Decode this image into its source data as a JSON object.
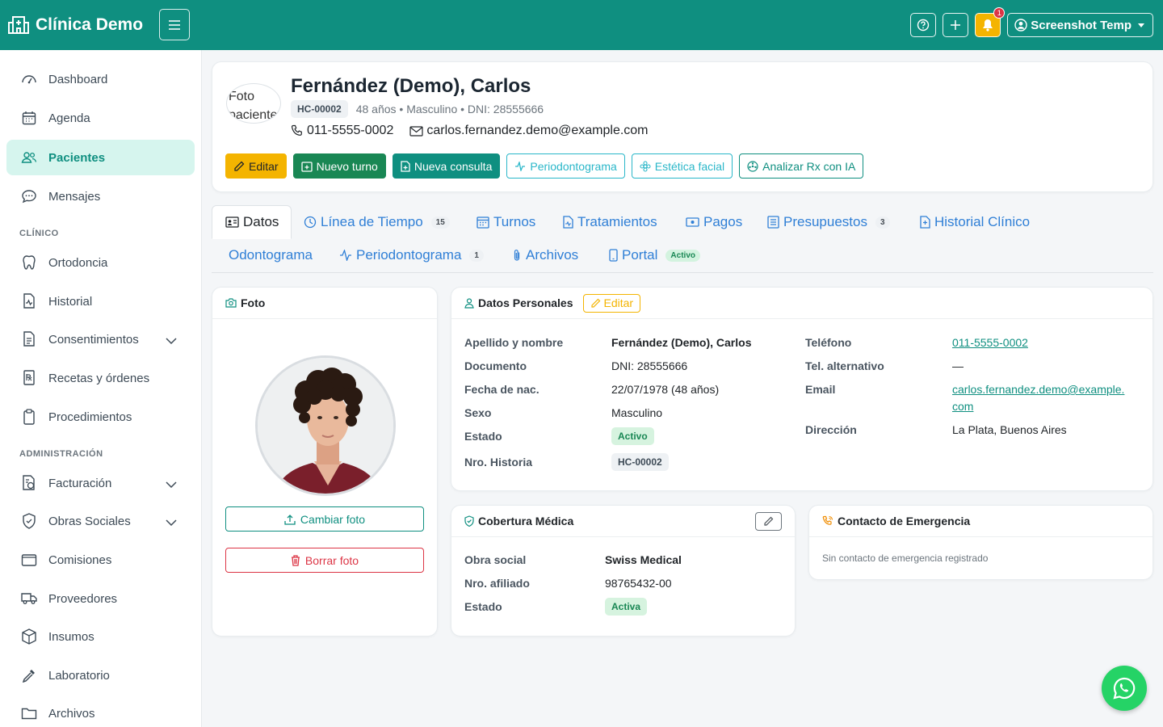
{
  "brand": {
    "name": "Clínica Demo",
    "accent": "#0f8f80"
  },
  "topbar": {
    "notif_count": "1",
    "user_label": "Screenshot Temp"
  },
  "sidebar": {
    "items": [
      {
        "label": "Dashboard",
        "icon": "speedometer-icon"
      },
      {
        "label": "Agenda",
        "icon": "calendar-icon"
      },
      {
        "label": "Pacientes",
        "icon": "people-icon",
        "active": true
      },
      {
        "label": "Mensajes",
        "icon": "chat-icon"
      }
    ],
    "section_clinico": "CLÍNICO",
    "clinico_items": [
      {
        "label": "Ortodoncia",
        "icon": "tooth-icon"
      },
      {
        "label": "Historial",
        "icon": "file-medical-icon"
      },
      {
        "label": "Consentimientos",
        "icon": "file-check-icon",
        "chevron": true
      },
      {
        "label": "Recetas y órdenes",
        "icon": "prescription-icon"
      },
      {
        "label": "Procedimientos",
        "icon": "clipboard-icon"
      }
    ],
    "section_admin": "ADMINISTRACIÓN",
    "admin_items": [
      {
        "label": "Facturación",
        "icon": "receipt-icon",
        "chevron": true
      },
      {
        "label": "Obras Sociales",
        "icon": "shield-icon",
        "chevron": true
      },
      {
        "label": "Comisiones",
        "icon": "wallet-icon"
      },
      {
        "label": "Proveedores",
        "icon": "truck-icon"
      },
      {
        "label": "Insumos",
        "icon": "box-icon"
      },
      {
        "label": "Laboratorio",
        "icon": "eyedropper-icon"
      },
      {
        "label": "Archivos",
        "icon": "folder-icon"
      }
    ]
  },
  "patient": {
    "photo_alt": "Foto paciente",
    "name": "Fernández (Demo), Carlos",
    "hc": "HC-00002",
    "meta": "48 años • Masculino • DNI: 28555666",
    "phone": "011-5555-0002",
    "email": "carlos.fernandez.demo@example.com"
  },
  "actions": {
    "edit": "Editar",
    "new_turn": "Nuevo turno",
    "new_consult": "Nueva consulta",
    "perio": "Periodontograma",
    "estetica": "Estética facial",
    "rx": "Analizar Rx con IA"
  },
  "tabs": {
    "datos": "Datos",
    "timeline": "Línea de Tiempo",
    "timeline_count": "15",
    "turnos": "Turnos",
    "tratamientos": "Tratamientos",
    "pagos": "Pagos",
    "presupuestos": "Presupuestos",
    "presupuestos_count": "3",
    "historial": "Historial Clínico",
    "odontograma": "Odontograma",
    "perio": "Periodontograma",
    "perio_count": "1",
    "archivos": "Archivos",
    "portal": "Portal",
    "portal_status": "Activo"
  },
  "foto_card": {
    "title": "Foto",
    "change": "Cambiar foto",
    "delete": "Borrar foto"
  },
  "datos_personales": {
    "title": "Datos Personales",
    "edit": "Editar",
    "labels": {
      "nombre": "Apellido y nombre",
      "documento": "Documento",
      "nacimiento": "Fecha de nac.",
      "sexo": "Sexo",
      "estado": "Estado",
      "historia": "Nro. Historia",
      "telefono": "Teléfono",
      "tel_alt": "Tel. alternativo",
      "email": "Email",
      "direccion": "Dirección"
    },
    "values": {
      "nombre": "Fernández (Demo), Carlos",
      "documento": "DNI: 28555666",
      "nacimiento": "22/07/1978 (48 años)",
      "sexo": "Masculino",
      "estado": "Activo",
      "historia": "HC-00002",
      "telefono": "011-5555-0002",
      "tel_alt": "—",
      "email_1": "carlos.fernandez.demo@example.",
      "email_2": "com",
      "direccion": "La Plata, Buenos Aires"
    }
  },
  "cobertura": {
    "title": "Cobertura Médica",
    "labels": {
      "obra": "Obra social",
      "afiliado": "Nro. afiliado",
      "estado": "Estado"
    },
    "values": {
      "obra": "Swiss Medical",
      "afiliado": "98765432-00",
      "estado": "Activa"
    }
  },
  "emergencia": {
    "title": "Contacto de Emergencia",
    "empty": "Sin contacto de emergencia registrado"
  }
}
